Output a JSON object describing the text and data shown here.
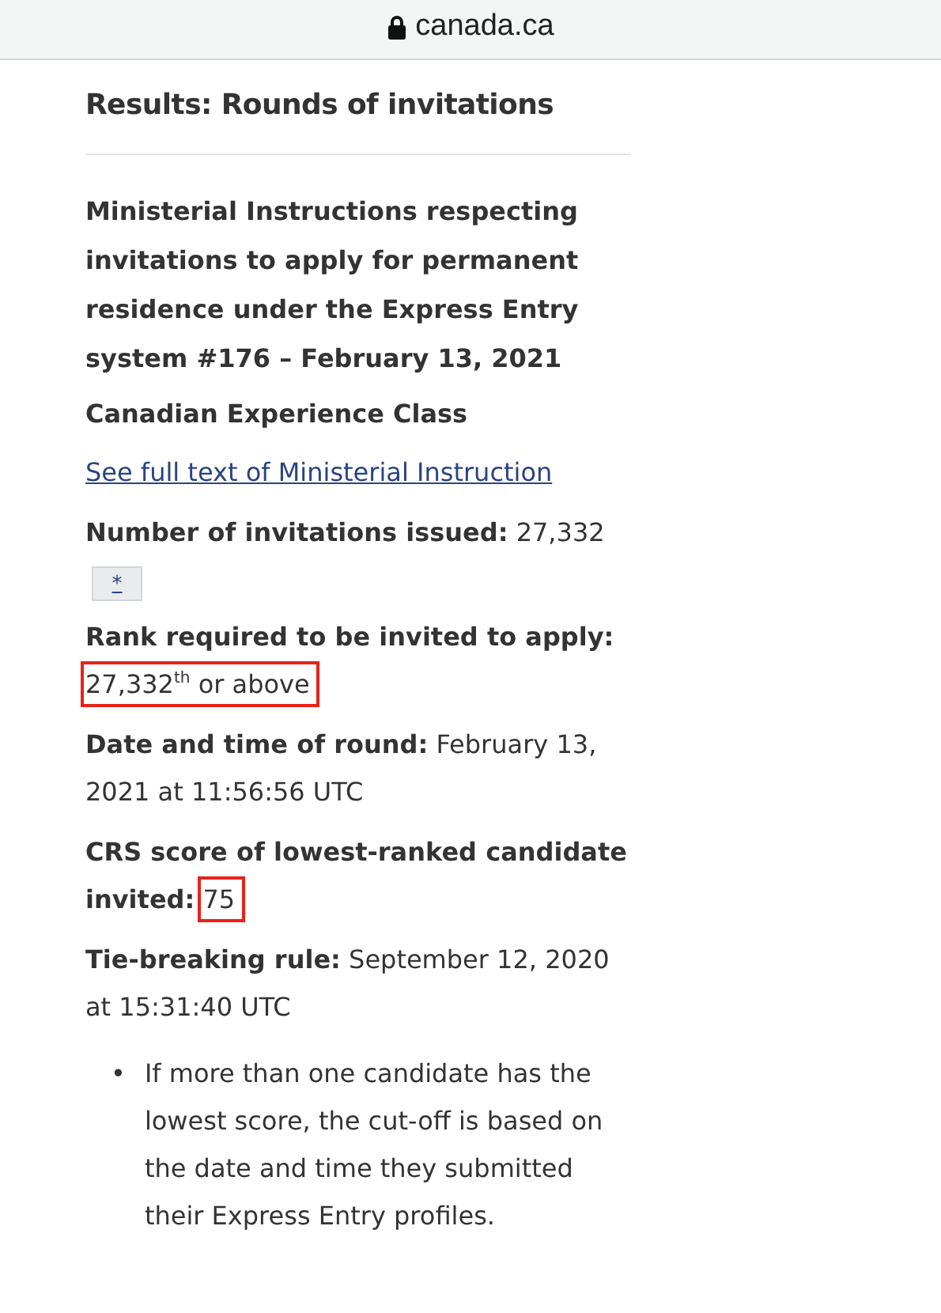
{
  "address_bar": {
    "url": "canada.ca",
    "secure": true
  },
  "page_title": "Results: Rounds of invitations",
  "heading": "Ministerial Instructions respecting invitations to apply for permanent residence under the Express Entry system #176 – February 13, 2021",
  "subheading": "Canadian Experience Class",
  "link": "See full text of Ministerial Instruction",
  "facts": [
    {
      "label": "Number of invitations issued:",
      "value": "27,332",
      "highlighted": false,
      "footnote": "*"
    },
    {
      "label": "Rank required to be invited to apply:",
      "value": "27,332$^{th}$ or above",
      "highlighted": true
    },
    {
      "label": "Date and time of round:",
      "value": "February 13, 2021 at 11:56:56 UTC",
      "highlighted": false
    },
    {
      "label": "CRS score of lowest-ranked candidate invited:",
      "value": "75",
      "highlighted": true
    },
    {
      "label": "Tie-breaking rule:",
      "value": "September 12, 2020 at 15:31:40 UTC",
      "highlighted": false
    }
  ],
  "bullets": [
    {
      "marker": "•",
      "text": "If more than one candidate has the lowest score, the cut-off is based on the date and time they submitted their Express Entry profiles."
    }
  ]
}
